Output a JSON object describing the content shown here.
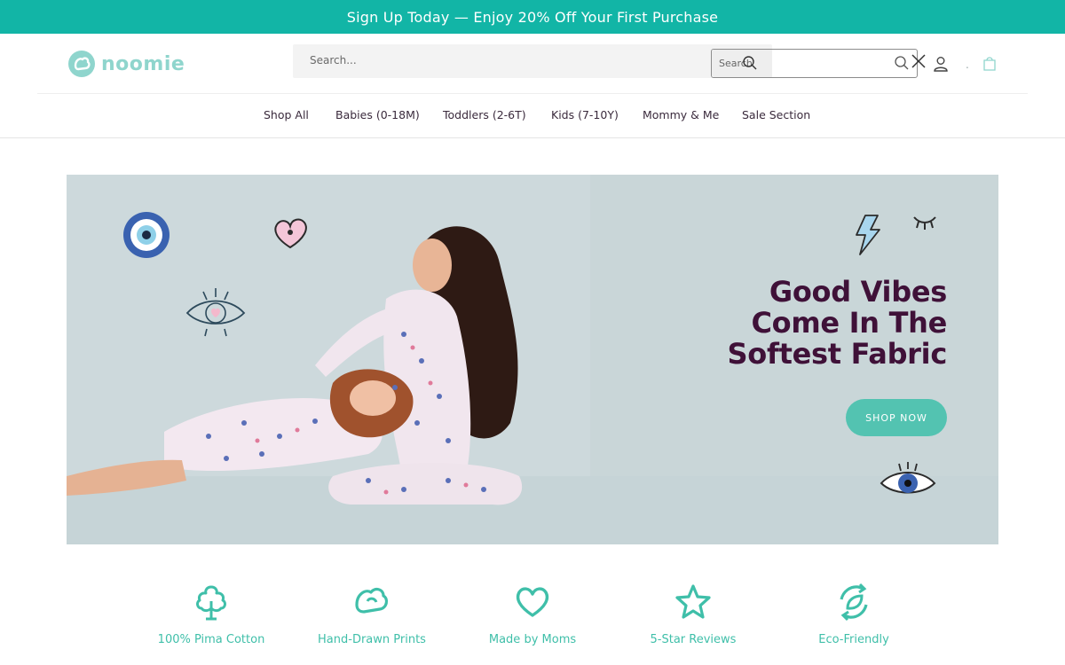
{
  "announcement": {
    "text": "Sign Up Today — Enjoy 20% Off Your First Purchase"
  },
  "brand": {
    "name": "noomie",
    "accent": "#12b5a6",
    "logo_color": "#8fd5cd"
  },
  "header": {
    "search_placeholder": "Search...",
    "popup_label": "Search",
    "separator": "."
  },
  "nav": {
    "items": [
      {
        "label": "Shop All"
      },
      {
        "label": "Babies (0-18M)"
      },
      {
        "label": "Toddlers (2-6T)"
      },
      {
        "label": "Kids (7-10Y)"
      },
      {
        "label": "Mommy & Me"
      },
      {
        "label": "Sale Section"
      }
    ]
  },
  "hero": {
    "headline_line1": "Good Vibes",
    "headline_line2": "Come In The",
    "headline_line3": "Softest Fabric",
    "button": "SHOP NOW",
    "button_color": "#53c3b1",
    "headline_color": "#3f1138"
  },
  "features": [
    {
      "label": "100% Pima Cotton",
      "icon": "cotton-icon"
    },
    {
      "label": "Hand-Drawn Prints",
      "icon": "hand-drawn-icon"
    },
    {
      "label": "Made by Moms",
      "icon": "heart-icon"
    },
    {
      "label": "5-Star Reviews",
      "icon": "star-icon"
    },
    {
      "label": "Eco-Friendly",
      "icon": "eco-icon"
    }
  ]
}
